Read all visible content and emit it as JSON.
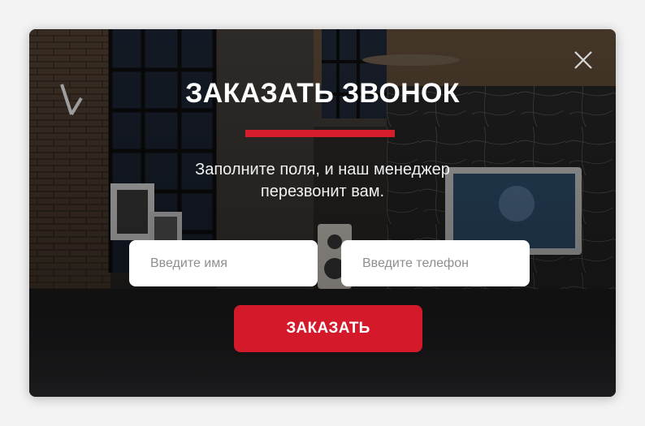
{
  "modal": {
    "title": "ЗАКАЗАТЬ ЗВОНОК",
    "subtitle": "Заполните поля, и наш менеджер перезвонит вам.",
    "name_placeholder": "Введите имя",
    "phone_placeholder": "Введите телефон",
    "submit_label": "ЗАКАЗАТЬ",
    "close_icon": "close-icon"
  },
  "colors": {
    "accent": "#d41a2a",
    "text_light": "#ffffff",
    "field_bg": "#ffffff",
    "placeholder": "#8e8e8e"
  }
}
